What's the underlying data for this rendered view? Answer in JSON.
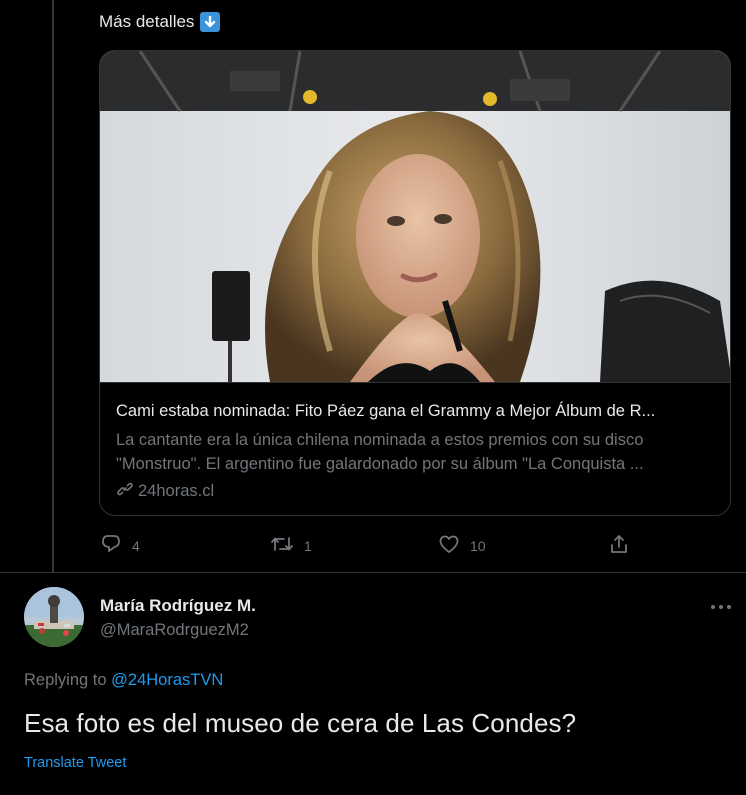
{
  "thread": {
    "more_details_text": "Más detalles",
    "more_details_emoji": "down-arrow-emoji"
  },
  "card": {
    "title": "Cami estaba nominada: Fito Páez gana el Grammy a Mejor Álbum de R...",
    "description_line1": "La cantante era la única chilena nominada a estos premios con su disco",
    "description_line2": "\"Monstruo\". El argentino fue galardonado por su álbum \"La Conquista ...",
    "domain": "24horas.cl",
    "image_alt": "portrait photo of woman with long wavy blonde hair in studio"
  },
  "actions": {
    "reply_count": "4",
    "retweet_count": "1",
    "like_count": "10"
  },
  "reply": {
    "author_name": "María Rodríguez M.",
    "author_handle": "@MaraRodrguezM2",
    "replying_prefix": "Replying to",
    "replying_to": "@24HorasTVN",
    "text": "Esa foto es del museo de cera de Las Condes?",
    "translate_label": "Translate Tweet"
  },
  "colors": {
    "background": "#000000",
    "text_primary": "#e7e9ea",
    "text_secondary": "#71767b",
    "accent": "#1d9bf0",
    "border": "#2f3336"
  }
}
